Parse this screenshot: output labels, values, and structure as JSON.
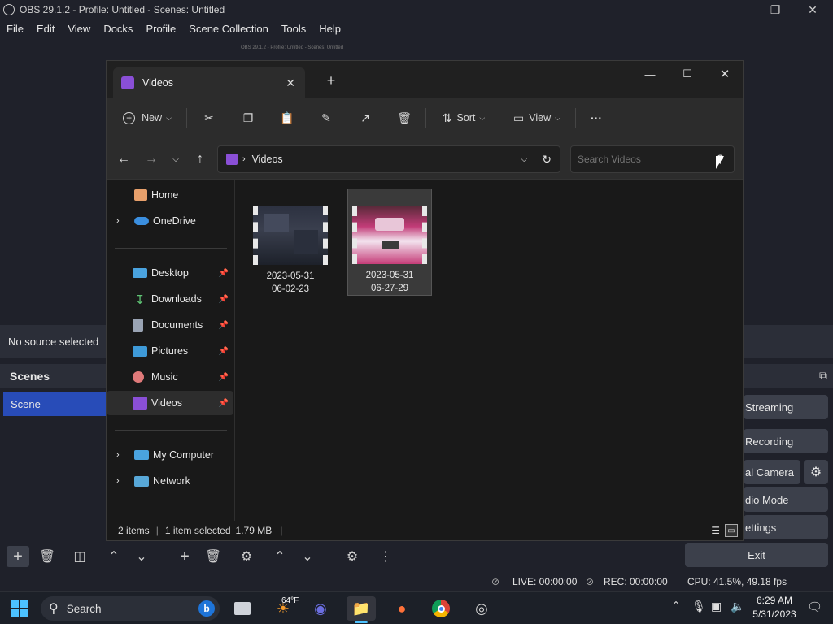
{
  "obs": {
    "title": "OBS 29.1.2 - Profile: Untitled - Scenes: Untitled",
    "menu": [
      "File",
      "Edit",
      "View",
      "Docks",
      "Profile",
      "Scene Collection",
      "Tools",
      "Help"
    ],
    "preview_ghost_title": "OBS 29.1.2 - Profile: Untitled - Scenes: Untitled",
    "no_source": "No source selected",
    "scenes_header": "Scenes",
    "scene_item": "Scene",
    "controls": {
      "streaming": "Streaming",
      "recording": "Recording",
      "virtual_camera": "al Camera",
      "studio_mode": "dio Mode",
      "settings": "ettings",
      "exit": "Exit"
    },
    "status": {
      "live": "LIVE: 00:00:00",
      "rec": "REC: 00:00:00",
      "cpu": "CPU: 41.5%, 49.18 fps"
    }
  },
  "explorer": {
    "tab_title": "Videos",
    "toolbar": {
      "new_label": "New",
      "sort_label": "Sort",
      "view_label": "View",
      "more_label": "···"
    },
    "address": "Videos",
    "search_placeholder": "Search Videos",
    "nav": {
      "home": "Home",
      "onedrive": "OneDrive",
      "desktop": "Desktop",
      "downloads": "Downloads",
      "documents": "Documents",
      "pictures": "Pictures",
      "music": "Music",
      "videos": "Videos",
      "my_computer": "My Computer",
      "network": "Network"
    },
    "files": [
      {
        "line1": "2023-05-31",
        "line2": "06-02-23"
      },
      {
        "line1": "2023-05-31",
        "line2": "06-27-29"
      }
    ],
    "status": {
      "items": "2 items",
      "selected": "1 item selected",
      "size": "1.79 MB"
    }
  },
  "taskbar": {
    "search_label": "Search",
    "weather": "64°F",
    "time": "6:29 AM",
    "date": "5/31/2023"
  },
  "colors": {
    "obs_bg": "#1f212a",
    "obs_accent": "#284cb8",
    "explorer_bg": "#191919",
    "video_purple": "#8a4fd6"
  }
}
